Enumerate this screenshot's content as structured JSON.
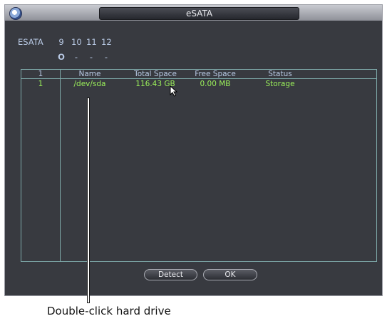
{
  "window": {
    "title": "eSATA"
  },
  "esata": {
    "label": "ESATA",
    "ports": [
      "9",
      "10",
      "11",
      "12"
    ],
    "port_status": [
      "O",
      "-",
      "-",
      "-"
    ]
  },
  "table": {
    "headers": [
      "1",
      "Name",
      "Total Space",
      "Free Space",
      "Status"
    ],
    "rows": [
      {
        "num": "1",
        "name": "/dev/sda",
        "total": "116.43 GB",
        "free": "0.00 MB",
        "status": "Storage"
      }
    ]
  },
  "buttons": {
    "detect": "Detect",
    "ok": "OK"
  },
  "callout": {
    "text": "Double-click hard drive"
  },
  "colors": {
    "window_bg": "#383a40",
    "accent_text": "#b8c9e4",
    "data_text": "#9bf05a",
    "frame": "#7ea9a9"
  },
  "icons": {
    "app": "app-globe-icon",
    "cursor": "mouse-pointer-icon"
  }
}
